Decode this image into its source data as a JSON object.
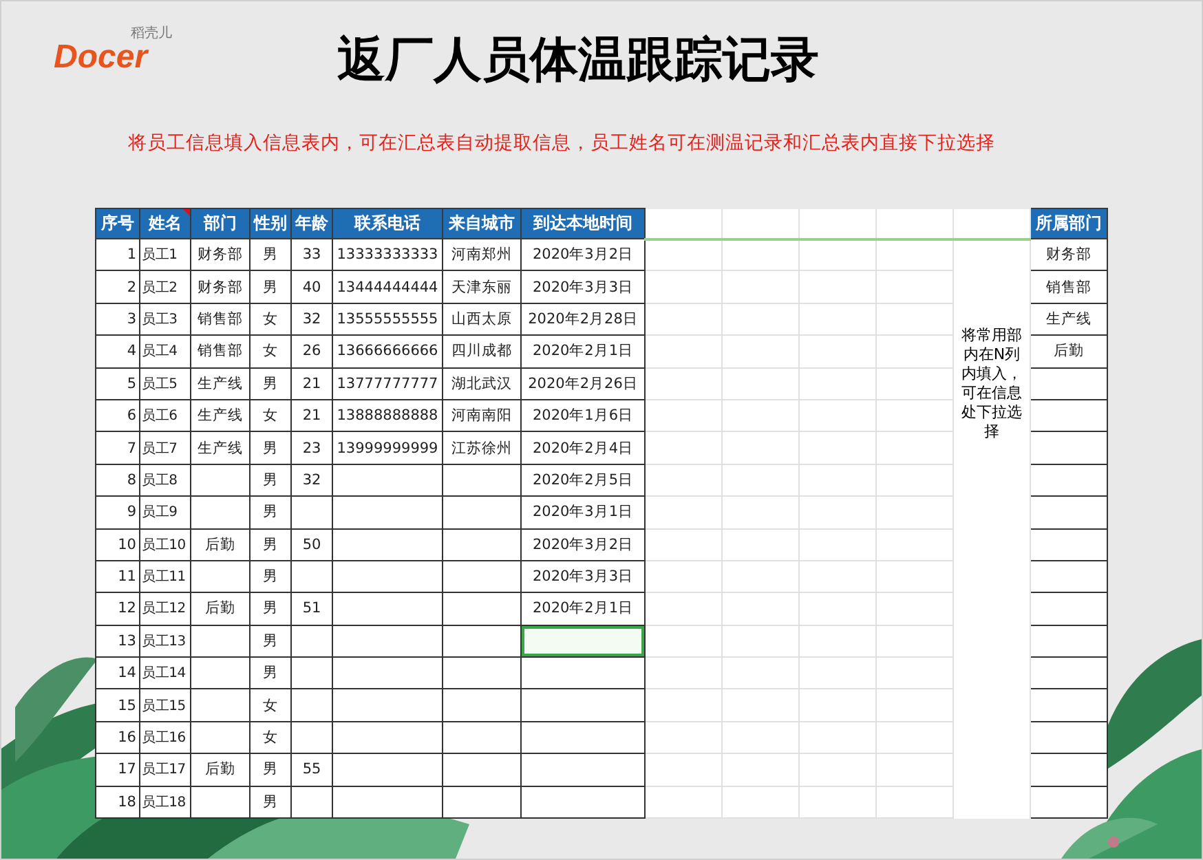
{
  "logo": {
    "brand": "Docer",
    "tagline": "稻壳儿"
  },
  "title": "返厂人员体温跟踪记录",
  "instruction": "将员工信息填入信息表内，可在汇总表自动提取信息，员工姓名可在测温记录和汇总表内直接下拉选择",
  "columns": [
    {
      "label": "序号",
      "has_comment": false
    },
    {
      "label": "姓名",
      "has_comment": true
    },
    {
      "label": "部门",
      "has_comment": false
    },
    {
      "label": "性别",
      "has_comment": false
    },
    {
      "label": "年龄",
      "has_comment": false
    },
    {
      "label": "联系电话",
      "has_comment": false
    },
    {
      "label": "来自城市",
      "has_comment": false
    },
    {
      "label": "到达本地时间",
      "has_comment": false
    }
  ],
  "rows": [
    {
      "no": "1",
      "name": "员工1",
      "dept": "财务部",
      "gender": "男",
      "age": "33",
      "phone": "13333333333",
      "city": "河南郑州",
      "arrival": "2020年3月2日",
      "arrival_selected": false
    },
    {
      "no": "2",
      "name": "员工2",
      "dept": "财务部",
      "gender": "男",
      "age": "40",
      "phone": "13444444444",
      "city": "天津东丽",
      "arrival": "2020年3月3日",
      "arrival_selected": false
    },
    {
      "no": "3",
      "name": "员工3",
      "dept": "销售部",
      "gender": "女",
      "age": "32",
      "phone": "13555555555",
      "city": "山西太原",
      "arrival": "2020年2月28日",
      "arrival_selected": false
    },
    {
      "no": "4",
      "name": "员工4",
      "dept": "销售部",
      "gender": "女",
      "age": "26",
      "phone": "13666666666",
      "city": "四川成都",
      "arrival": "2020年2月1日",
      "arrival_selected": false
    },
    {
      "no": "5",
      "name": "员工5",
      "dept": "生产线",
      "gender": "男",
      "age": "21",
      "phone": "13777777777",
      "city": "湖北武汉",
      "arrival": "2020年2月26日",
      "arrival_selected": false
    },
    {
      "no": "6",
      "name": "员工6",
      "dept": "生产线",
      "gender": "女",
      "age": "21",
      "phone": "13888888888",
      "city": "河南南阳",
      "arrival": "2020年1月6日",
      "arrival_selected": false
    },
    {
      "no": "7",
      "name": "员工7",
      "dept": "生产线",
      "gender": "男",
      "age": "23",
      "phone": "13999999999",
      "city": "江苏徐州",
      "arrival": "2020年2月4日",
      "arrival_selected": false
    },
    {
      "no": "8",
      "name": "员工8",
      "gender": "男",
      "age": "32",
      "arrival": "2020年2月5日",
      "arrival_selected": false
    },
    {
      "no": "9",
      "name": "员工9",
      "gender": "男",
      "arrival": "2020年3月1日",
      "arrival_selected": false
    },
    {
      "no": "10",
      "name": "员工10",
      "dept": "后勤",
      "gender": "男",
      "age": "50",
      "arrival": "2020年3月2日",
      "arrival_selected": false
    },
    {
      "no": "11",
      "name": "员工11",
      "gender": "男",
      "arrival": "2020年3月3日",
      "arrival_selected": false
    },
    {
      "no": "12",
      "name": "员工12",
      "dept": "后勤",
      "gender": "男",
      "age": "51",
      "arrival": "2020年2月1日",
      "arrival_selected": false
    },
    {
      "no": "13",
      "name": "员工13",
      "gender": "男",
      "arrival_selected": true
    },
    {
      "no": "14",
      "name": "员工14",
      "gender": "男",
      "arrival_selected": false
    },
    {
      "no": "15",
      "name": "员工15",
      "gender": "女",
      "arrival_selected": false
    },
    {
      "no": "16",
      "name": "员工16",
      "gender": "女",
      "arrival_selected": false
    },
    {
      "no": "17",
      "name": "员工17",
      "dept": "后勤",
      "gender": "男",
      "age": "55",
      "arrival_selected": false
    },
    {
      "no": "18",
      "name": "员工18",
      "gender": "男",
      "arrival_selected": false
    }
  ],
  "note": "将常用部内在N列内填入，可在信息处下拉选择",
  "dept_list": {
    "header": "所属部门",
    "items": [
      "财务部",
      "销售部",
      "生产线",
      "后勤"
    ]
  }
}
